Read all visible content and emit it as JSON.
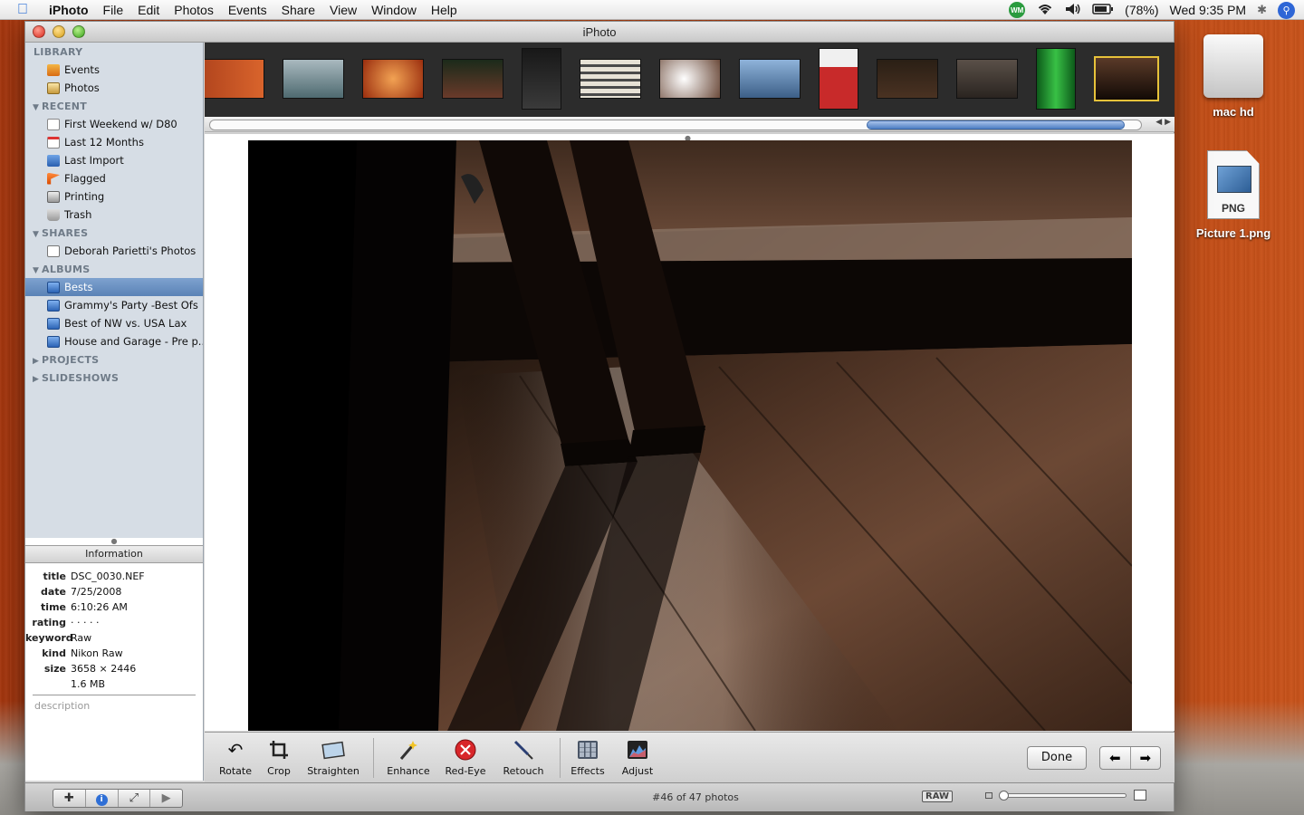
{
  "menubar": {
    "app": "iPhoto",
    "menus": [
      "File",
      "Edit",
      "Photos",
      "Events",
      "Share",
      "View",
      "Window",
      "Help"
    ],
    "wm_badge": "WM",
    "battery": "(78%)",
    "clock": "Wed 9:35 PM"
  },
  "window": {
    "title": "iPhoto"
  },
  "sidebar": {
    "library": {
      "heading": "LIBRARY",
      "items": [
        "Events",
        "Photos"
      ]
    },
    "recent": {
      "heading": "RECENT",
      "items": [
        "First Weekend w/ D80",
        "Last 12 Months",
        "Last Import",
        "Flagged",
        "Printing",
        "Trash"
      ]
    },
    "shares": {
      "heading": "SHARES",
      "items": [
        "Deborah Parietti's Photos"
      ]
    },
    "albums": {
      "heading": "ALBUMS",
      "items": [
        "Bests",
        "Grammy's Party -Best Ofs",
        "Best of NW vs. USA Lax",
        "House and Garage - Pre p..."
      ],
      "selected": "Bests"
    },
    "projects": {
      "heading": "PROJECTS"
    },
    "slideshows": {
      "heading": "SLIDESHOWS"
    }
  },
  "info": {
    "header": "Information",
    "rows": [
      {
        "k": "title",
        "v": "DSC_0030.NEF"
      },
      {
        "k": "date",
        "v": "7/25/2008"
      },
      {
        "k": "time",
        "v": "6:10:26 AM"
      },
      {
        "k": "rating",
        "v": "· · · · ·"
      },
      {
        "k": "keyword",
        "v": "Raw"
      },
      {
        "k": "kind",
        "v": "Nikon Raw"
      },
      {
        "k": "size",
        "v": "3658 × 2446"
      },
      {
        "k": "",
        "v": "1.6 MB"
      }
    ],
    "description_placeholder": "description"
  },
  "toolbar": {
    "tools": [
      "Rotate",
      "Crop",
      "Straighten",
      "Enhance",
      "Red-Eye",
      "Retouch",
      "Effects",
      "Adjust"
    ],
    "done": "Done"
  },
  "statusbar": {
    "count": "#46 of 47 photos",
    "raw_badge": "RAW"
  },
  "desktop": {
    "icons": [
      "mac hd",
      "Picture 1.png"
    ],
    "png_label": "PNG"
  },
  "filmstrip": {
    "selected_index": 12,
    "count": 13
  }
}
